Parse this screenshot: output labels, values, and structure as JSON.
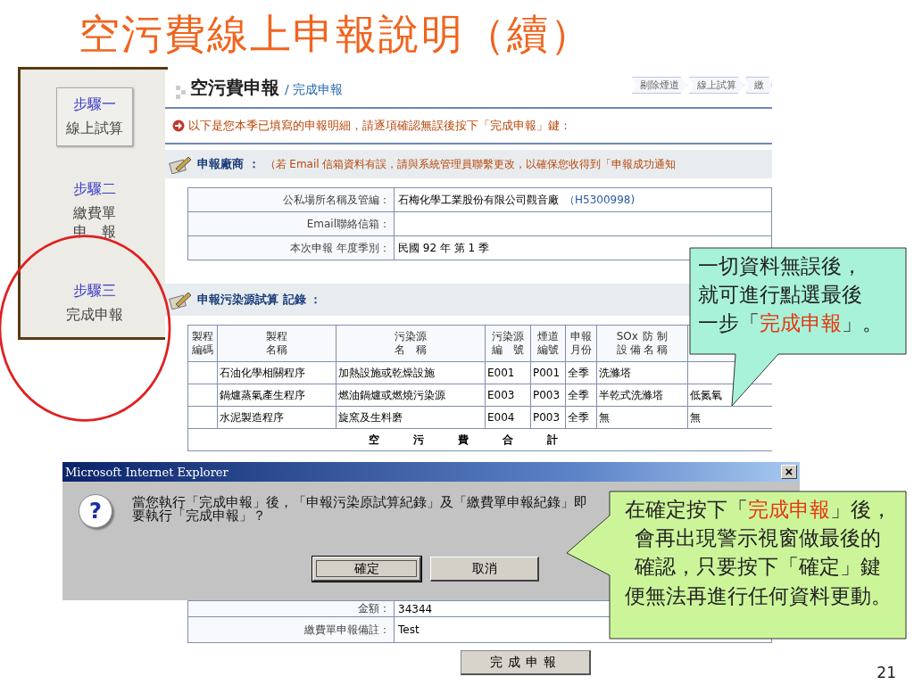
{
  "slide_title": "空污費線上申報說明（續）",
  "steps": [
    {
      "step": "步驟一",
      "label_lines": [
        "線上試算"
      ],
      "selected": true
    },
    {
      "step": "步驟二",
      "label_lines": [
        "繳費單",
        "申報"
      ],
      "selected": false
    },
    {
      "step": "步驟三",
      "label_lines": [
        "完成申報"
      ],
      "selected": false
    }
  ],
  "page": {
    "title": "空污費申報",
    "subtitle": "/ 完成申報",
    "breadcrumbs": [
      "剔除煙道",
      "線上試算",
      "繳"
    ],
    "notice": "以下是您本季已填寫的申報明細，請逐項確認無誤後按下「完成申報」鍵：",
    "company_section": {
      "title": "申報廠商 ：",
      "note": "（若 Email 信箱資料有誤，請與系統管理員聯繫更改，以確保您收得到「申報成功通知"
    },
    "company_rows": [
      {
        "label": "公私場所名稱及管編：",
        "value": "石梅化學工業股份有限公司觀音廠",
        "code": "（H5300998)"
      },
      {
        "label": "Email聯絡信箱："
      },
      {
        "label": "本次申報 年度季別：",
        "value": "民國 92 年 第 1 季"
      }
    ],
    "records_section": {
      "title": "申報污染源試算 記錄 ："
    },
    "records_columns": [
      "製程編碼",
      "製程名稱",
      "污染源名稱",
      "污染源編號",
      "煙道編號",
      "申報月份",
      "SOx防制設備名稱"
    ],
    "records_rows": [
      {
        "process_name": "石油化學相關程序",
        "source_name": "加熱設施或乾燥設施",
        "source_no": "E001",
        "stack_no": "P001",
        "month": "全季",
        "sox_device": "洗滌塔"
      },
      {
        "process_name": "鍋爐蒸氣產生程序",
        "source_name": "燃油鍋爐或燃燒污染源",
        "source_no": "E003",
        "stack_no": "P003",
        "month": "全季",
        "sox_device": "半乾式洗滌塔",
        "column_8": "低氮氧"
      },
      {
        "process_name": "水泥製造程序",
        "source_name": "旋窯及生料磨",
        "source_no": "E004",
        "stack_no": "P003",
        "month": "全季",
        "sox_device": "無",
        "column_8": "無"
      }
    ],
    "records_total": "空污費合計",
    "bill_rows": [
      {
        "label": "金額：",
        "value": "34344"
      },
      {
        "label": "繳費單申報備註：",
        "value": "Test"
      }
    ],
    "submit_button": "完成申報"
  },
  "dialog": {
    "title": "Microsoft Internet Explorer",
    "close": "×",
    "icon": "?",
    "message_lines": [
      "當您執行「完成申報」後，「申報污染原試算紀錄」及「繳費單申報紀錄」即",
      "要執行「完成申報」？"
    ],
    "buttons": [
      {
        "label": "確定",
        "selected": true
      },
      {
        "label": "取消",
        "selected": false
      }
    ]
  },
  "callouts": [
    {
      "kind": "down",
      "lines": [
        [
          {
            "text": "一切資料無誤後，"
          }
        ],
        [
          {
            "text": "就可進行點選最後"
          }
        ],
        [
          {
            "text": "一步「"
          },
          {
            "text": "完成申報",
            "highlight": true
          },
          {
            "text": "」。"
          }
        ]
      ]
    },
    {
      "kind": "left",
      "lines": [
        [
          {
            "text": "在確定按下「"
          },
          {
            "text": "完成申報",
            "highlight": true
          },
          {
            "text": "」後，"
          }
        ],
        [
          {
            "text": "會再出現警示視窗做最後的"
          }
        ],
        [
          {
            "text": "確認，只要按下「確定」鍵"
          }
        ],
        [
          {
            "text": "便無法再進行任何資料更動。"
          }
        ]
      ]
    }
  ],
  "page_number": "21"
}
